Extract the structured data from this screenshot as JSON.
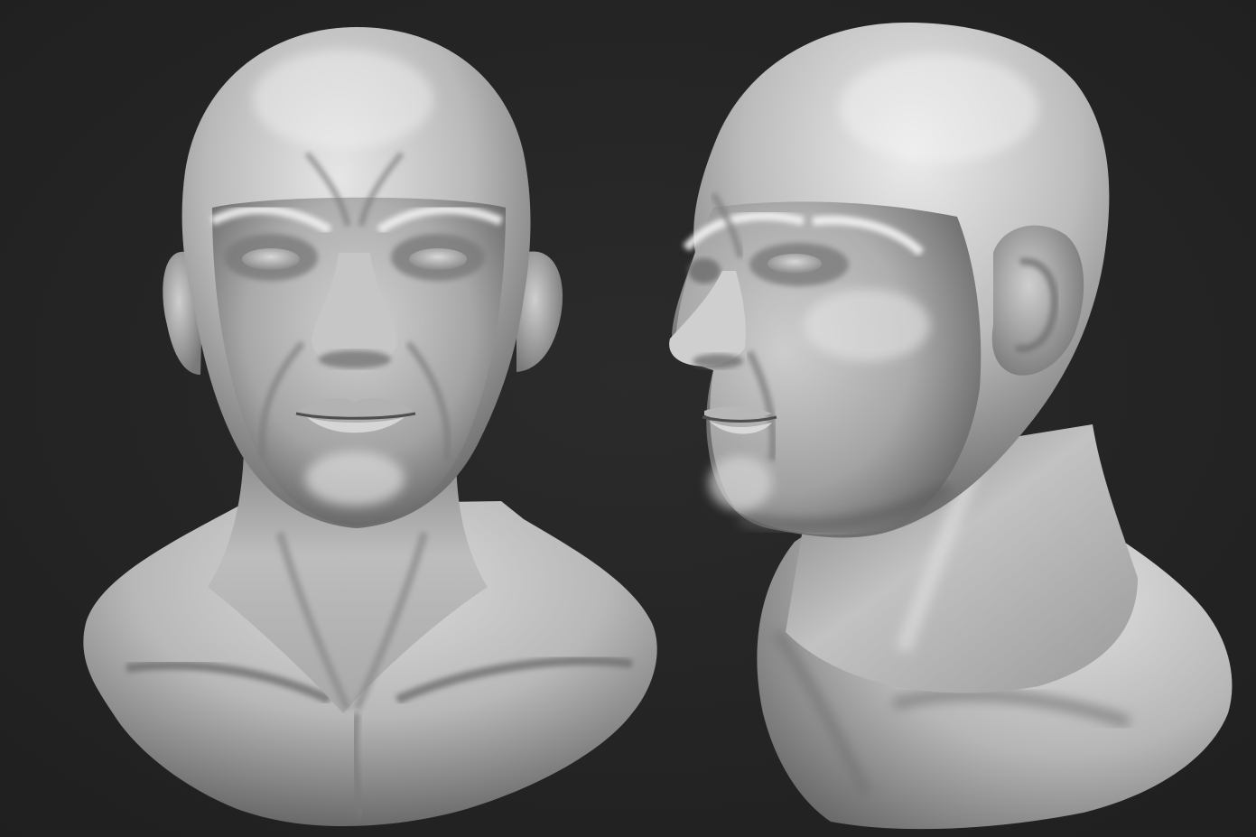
{
  "scene": {
    "background_color": "#262626",
    "material_color": "#b5b5b5",
    "highlight_color": "#eaeaea",
    "shadow_color": "#3a3a3a",
    "views": [
      {
        "name": "front-view"
      },
      {
        "name": "three-quarter-view"
      }
    ]
  }
}
